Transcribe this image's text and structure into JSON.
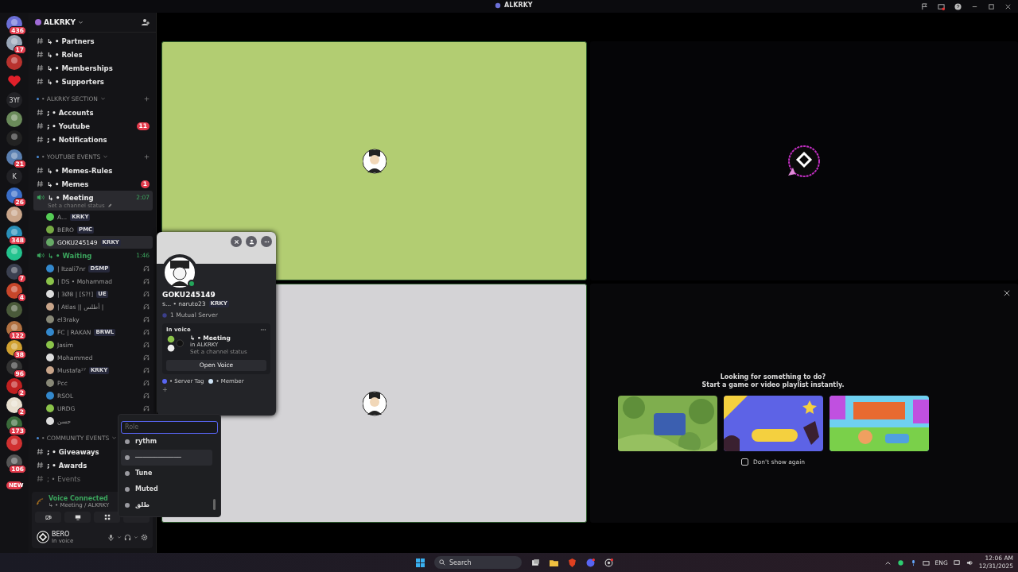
{
  "title_bar": {
    "title": "ALKRKY"
  },
  "servers": [
    {
      "kind": "avatar",
      "badge": "436"
    },
    {
      "kind": "avatar",
      "badge": "17"
    },
    {
      "kind": "avatar"
    },
    {
      "kind": "heart"
    },
    {
      "kind": "text",
      "label": "3Yf"
    },
    {
      "kind": "avatar"
    },
    {
      "kind": "avatar"
    },
    {
      "kind": "avatar",
      "badge": "21"
    },
    {
      "kind": "text",
      "label": "K"
    },
    {
      "kind": "avatar",
      "badge": "26"
    },
    {
      "kind": "avatar"
    },
    {
      "kind": "avatar",
      "badge": "348"
    },
    {
      "kind": "avatar"
    },
    {
      "kind": "avatar",
      "badge": "7"
    },
    {
      "kind": "avatar",
      "badge": "4"
    },
    {
      "kind": "avatar"
    },
    {
      "kind": "avatar",
      "badge": "122"
    },
    {
      "kind": "avatar",
      "badge": "38"
    },
    {
      "kind": "avatar",
      "badge": "96"
    },
    {
      "kind": "avatar",
      "badge": "2"
    },
    {
      "kind": "avatar",
      "badge": "2"
    },
    {
      "kind": "avatar",
      "badge": "173"
    },
    {
      "kind": "avatar"
    },
    {
      "kind": "avatar",
      "badge": "106"
    },
    {
      "kind": "new",
      "label": "NEW"
    }
  ],
  "server": {
    "name": "ALKRKY"
  },
  "channels": [
    {
      "kind": "text",
      "name": "↳ • Partners",
      "muted": false
    },
    {
      "kind": "text",
      "name": "↳ • Roles",
      "muted": false
    },
    {
      "kind": "text",
      "name": "↳ • Memberships",
      "muted": false
    },
    {
      "kind": "text",
      "name": "↳ • Supporters",
      "muted": false
    },
    {
      "kind": "category",
      "name": "• ALKRKY SECTION",
      "add_button": true
    },
    {
      "kind": "text",
      "name": "; • Accounts",
      "muted": false
    },
    {
      "kind": "text",
      "name": "; • Youtube",
      "badge": "11",
      "muted": false
    },
    {
      "kind": "text",
      "name": "; • Notifications",
      "muted": false
    },
    {
      "kind": "category",
      "name": "• YOUTUBE EVENTS",
      "add_button": true
    },
    {
      "kind": "text",
      "name": "↳ • Memes-Rules",
      "muted": false
    },
    {
      "kind": "text",
      "name": "↳ • Memes",
      "badge": "1",
      "muted": false
    },
    {
      "kind": "voice",
      "name": "↳ • Meeting",
      "time": "2:07",
      "status": "Set a channel status",
      "selected": true,
      "users": [
        {
          "name": "A...",
          "tag": "KRKY",
          "deafened": false,
          "selected": false
        },
        {
          "name": "BERO",
          "tag": "PMC",
          "deafened": false,
          "selected": false
        },
        {
          "name": "GOKU245149",
          "tag": "KRKY",
          "deafened": false,
          "selected": true
        }
      ]
    },
    {
      "kind": "voice",
      "name": "↳ • Waiting",
      "time": "1:46",
      "selected": false,
      "users": [
        {
          "name": "| Itzali7nr",
          "tag": "DSMP",
          "deafened": true,
          "selected": false
        },
        {
          "name": "| DS • Mohammad",
          "deafened": true,
          "selected": false
        },
        {
          "name": "| 3Ø8 | [S?!]",
          "tag": "UE",
          "deafened": true,
          "selected": false
        },
        {
          "name": "| Atlas || أطلس |",
          "deafened": true,
          "selected": false
        },
        {
          "name": "el3raky",
          "deafened": true,
          "selected": false
        },
        {
          "name": "FC | RAKAN",
          "tag": "BRWL",
          "deafened": true,
          "selected": false
        },
        {
          "name": "Jasim",
          "deafened": true,
          "selected": false
        },
        {
          "name": "Mohammed",
          "deafened": true,
          "selected": false
        },
        {
          "name": "Mustafa²⁷",
          "tag": "KRKY",
          "deafened": true,
          "selected": false
        },
        {
          "name": "Pcc",
          "deafened": true,
          "selected": false
        },
        {
          "name": "RSOL",
          "deafened": true,
          "selected": false
        },
        {
          "name": "URDG",
          "deafened": true,
          "selected": false
        },
        {
          "name": "حسن",
          "deafened": false,
          "selected": false
        }
      ]
    },
    {
      "kind": "category",
      "name": "• COMMUNITY EVENTS",
      "add_button": false
    },
    {
      "kind": "text",
      "name": "; • Giveaways",
      "muted": false
    },
    {
      "kind": "text",
      "name": "; • Awards",
      "muted": false
    },
    {
      "kind": "text",
      "name": "; • Events",
      "muted": true
    }
  ],
  "voice_panel": {
    "status": "Voice Connected",
    "channel": "↳ • Meeting / ALKRKY"
  },
  "user_panel": {
    "name": "BERO",
    "status": "In voice"
  },
  "tiles": [
    {
      "color": "#b2cd72",
      "kind": "figure"
    },
    {
      "color": "#050507",
      "kind": "badge"
    },
    {
      "color": "#d4d3d6",
      "kind": "figure"
    },
    {
      "color": "#08080a",
      "kind": "activities"
    }
  ],
  "activities": {
    "heading": "Looking for something to do?",
    "subheading": "Start a game or video playlist instantly.",
    "dont_show_again": {
      "label": "Don't show again",
      "checked": false
    }
  },
  "profile_popup": {
    "name": "GOKU245149",
    "subtitle": "s... • naruto23",
    "tag": "KRKY",
    "mutual": "1 Mutual Server",
    "voice_card": {
      "label": "In voice",
      "channel": "↳ • Meeting",
      "server": "in ALKRKY",
      "status": "Set a channel status",
      "button": "Open Voice"
    },
    "roles": [
      {
        "name": "• Server Tag",
        "color": "#5865f2"
      },
      {
        "name": "• Member",
        "color": "#cfe3f5"
      }
    ],
    "add": "+"
  },
  "role_picker": {
    "placeholder": "Role",
    "options": [
      {
        "name": "rythm",
        "highlighted": false
      },
      {
        "name": "────────────",
        "highlighted": true
      },
      {
        "name": "Tune",
        "highlighted": false
      },
      {
        "name": "Muted",
        "highlighted": false
      },
      {
        "name": "طلق",
        "highlighted": false
      }
    ]
  },
  "taskbar": {
    "search": "Search",
    "language": "ENG",
    "time": "12:06 AM",
    "date": "12/31/2025"
  }
}
